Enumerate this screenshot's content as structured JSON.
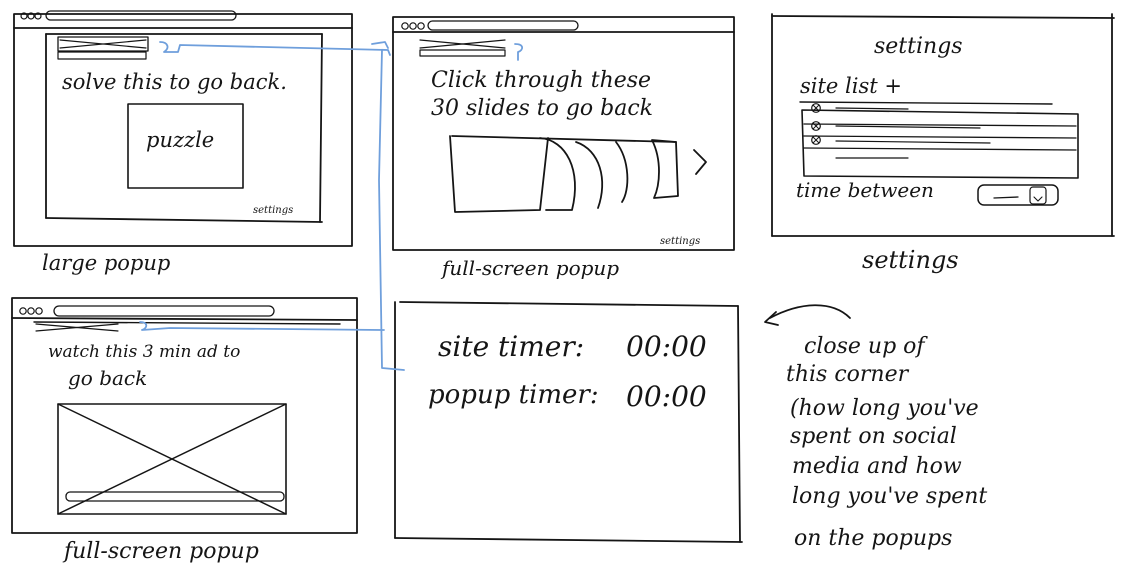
{
  "panels": {
    "large_popup": {
      "prompt": "solve this to go back.",
      "box": "puzzle",
      "settings_link": "settings",
      "caption": "large popup"
    },
    "slides_popup": {
      "prompt_line1": "Click through these",
      "prompt_line2": "30 slides to go back",
      "settings_link": "settings",
      "caption": "full-screen popup"
    },
    "settings": {
      "title": "settings",
      "site_list_label": "site list +",
      "time_between_label": "time between",
      "caption": "settings"
    },
    "ad_popup": {
      "prompt_line1": "watch this 3 min ad to",
      "prompt_line2": "go back",
      "caption": "full-screen popup"
    },
    "timer": {
      "site_timer_label": "site timer:",
      "site_timer_value": "00:00",
      "popup_timer_label": "popup timer:",
      "popup_timer_value": "00:00"
    }
  },
  "note": {
    "line1": "close up of",
    "line2": "this corner",
    "line3": "(how long you've",
    "line4": "spent on social",
    "line5": "media and how",
    "line6": "long you've spent",
    "line7": "on the popups"
  },
  "colors": {
    "ink": "#151515",
    "connector": "#6f9fdc"
  }
}
